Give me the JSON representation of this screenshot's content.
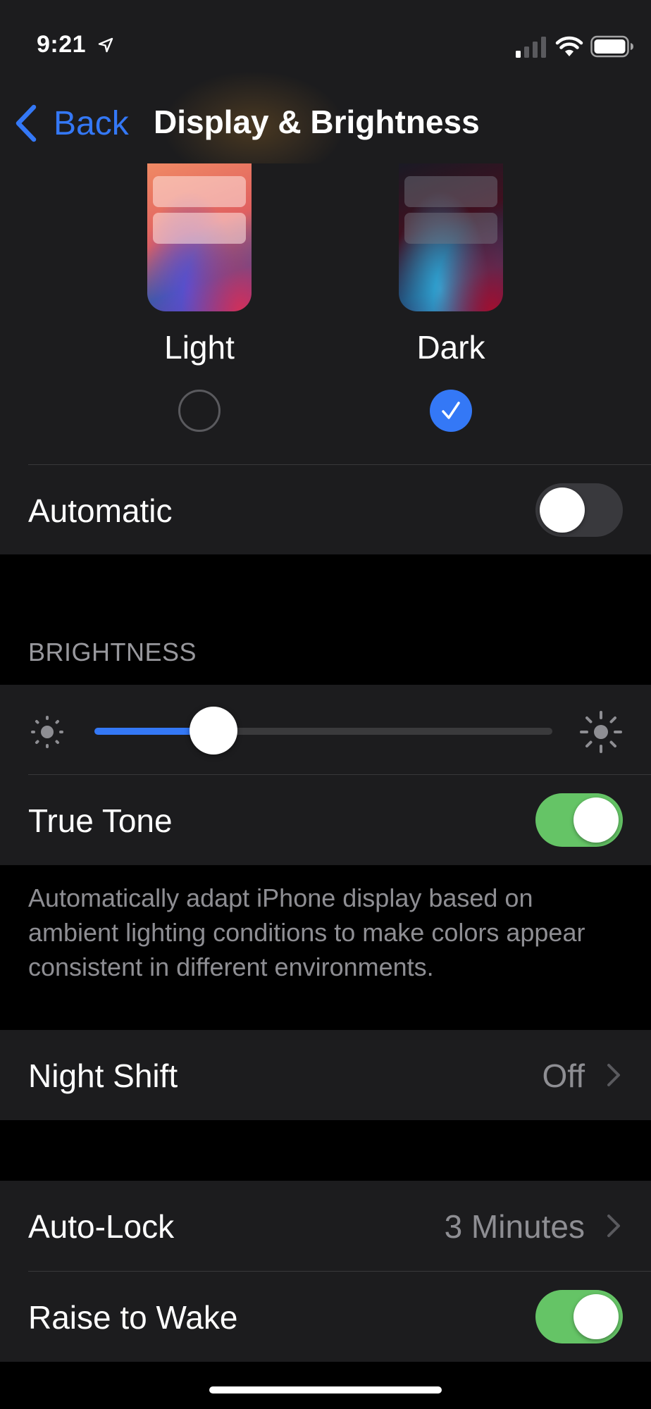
{
  "status_bar": {
    "time": "9:21",
    "location_icon": "location-arrow-icon",
    "signal_icon": "cellular-signal-icon",
    "wifi_icon": "wifi-icon",
    "battery_icon": "battery-icon"
  },
  "nav": {
    "back_label": "Back",
    "title": "Display & Brightness"
  },
  "appearance": {
    "light_label": "Light",
    "dark_label": "Dark",
    "selected": "Dark",
    "automatic_label": "Automatic",
    "automatic_on": false
  },
  "brightness": {
    "header": "BRIGHTNESS",
    "level": 0.26,
    "min_icon": "sun-small-icon",
    "max_icon": "sun-large-icon",
    "true_tone_label": "True Tone",
    "true_tone_on": true,
    "footer": "Automatically adapt iPhone display based on ambient lighting conditions to make colors appear consistent in different environments."
  },
  "night_shift": {
    "label": "Night Shift",
    "value": "Off"
  },
  "lock": {
    "auto_lock_label": "Auto-Lock",
    "auto_lock_value": "3 Minutes",
    "raise_to_wake_label": "Raise to Wake",
    "raise_to_wake_on": true
  },
  "colors": {
    "accent": "#3478f6",
    "toggle_on": "#65c466",
    "background": "#000000",
    "card": "#1c1c1e",
    "secondary_text": "#8e8e93"
  }
}
